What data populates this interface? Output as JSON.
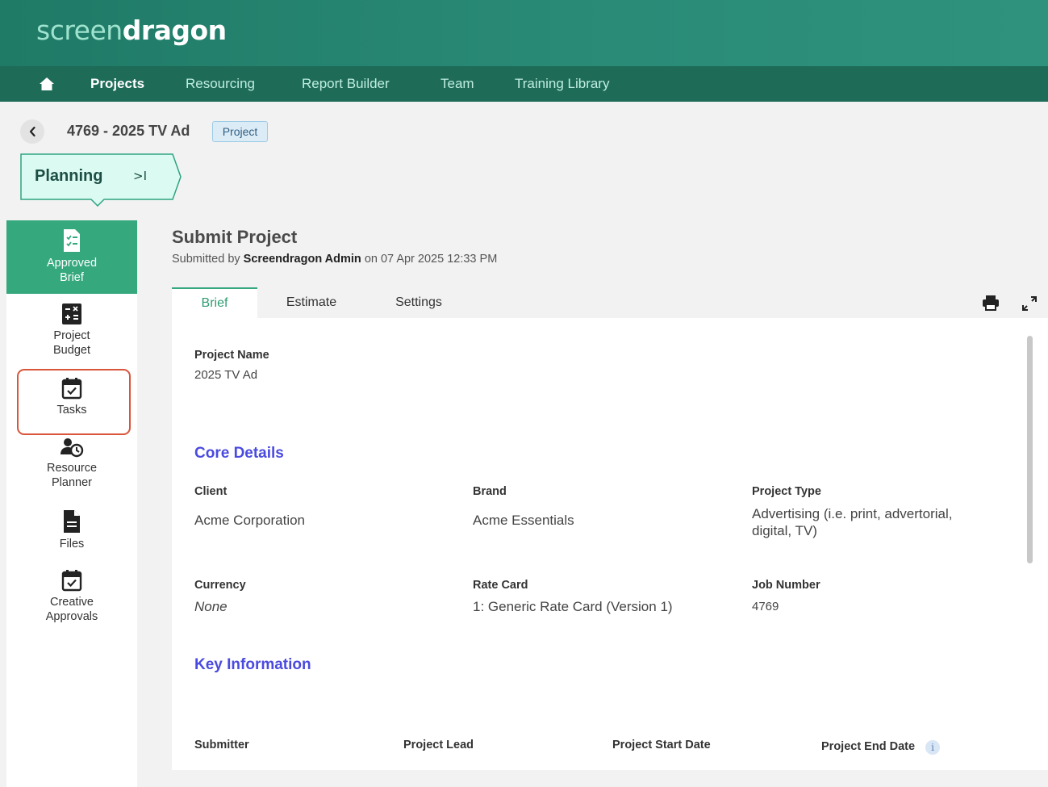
{
  "brand": {
    "logo_light": "screen",
    "logo_bold": "dragon"
  },
  "nav": {
    "home_icon": "home-icon",
    "items": [
      {
        "label": "Projects",
        "active": true
      },
      {
        "label": "Resourcing"
      },
      {
        "label": "Report Builder"
      },
      {
        "label": "Team"
      },
      {
        "label": "Training Library"
      }
    ]
  },
  "project": {
    "title": "4769 - 2025 TV Ad",
    "badge": "Project"
  },
  "stage": {
    "label": "Planning",
    "collapse_glyph": ">I"
  },
  "sidebar": {
    "items": [
      {
        "label_line1": "Approved",
        "label_line2": "Brief",
        "icon": "brief-doc-icon",
        "active": true
      },
      {
        "label_line1": "Project",
        "label_line2": "Budget",
        "icon": "calculator-icon"
      },
      {
        "label_line1": "Tasks",
        "label_line2": "",
        "icon": "calendar-check-icon",
        "highlighted": true
      },
      {
        "label_line1": "Resource",
        "label_line2": "Planner",
        "icon": "resource-planner-icon"
      },
      {
        "label_line1": "Files",
        "label_line2": "",
        "icon": "file-icon"
      },
      {
        "label_line1": "Creative",
        "label_line2": "Approvals",
        "icon": "approvals-icon"
      }
    ]
  },
  "submit": {
    "title": "Submit Project",
    "sub_prefix": "Submitted by",
    "sub_user": "Screendragon Admin",
    "sub_suffix": "on 07 Apr 2025 12:33 PM"
  },
  "tabs": [
    {
      "label": "Brief",
      "active": true
    },
    {
      "label": "Estimate"
    },
    {
      "label": "Settings"
    }
  ],
  "toolbar": {
    "print_icon": "print-icon",
    "expand_icon": "expand-icon"
  },
  "brief": {
    "project_name_label": "Project Name",
    "project_name_value": "2025 TV Ad",
    "core_details_title": "Core Details",
    "client_label": "Client",
    "client_value": "Acme Corporation",
    "brand_label": "Brand",
    "brand_value": "Acme Essentials",
    "project_type_label": "Project Type",
    "project_type_value_line1": "Advertising (i.e. print, advertorial,",
    "project_type_value_line2": "digital, TV)",
    "currency_label": "Currency",
    "currency_value": "None",
    "rate_card_label": "Rate Card",
    "rate_card_value": "1: Generic Rate Card (Version 1)",
    "job_number_label": "Job Number",
    "job_number_value": "4769",
    "key_info_title": "Key Information",
    "submitter_label": "Submitter",
    "project_lead_label": "Project Lead",
    "start_date_label": "Project Start Date",
    "end_date_label": "Project End Date",
    "info_glyph": "i"
  }
}
